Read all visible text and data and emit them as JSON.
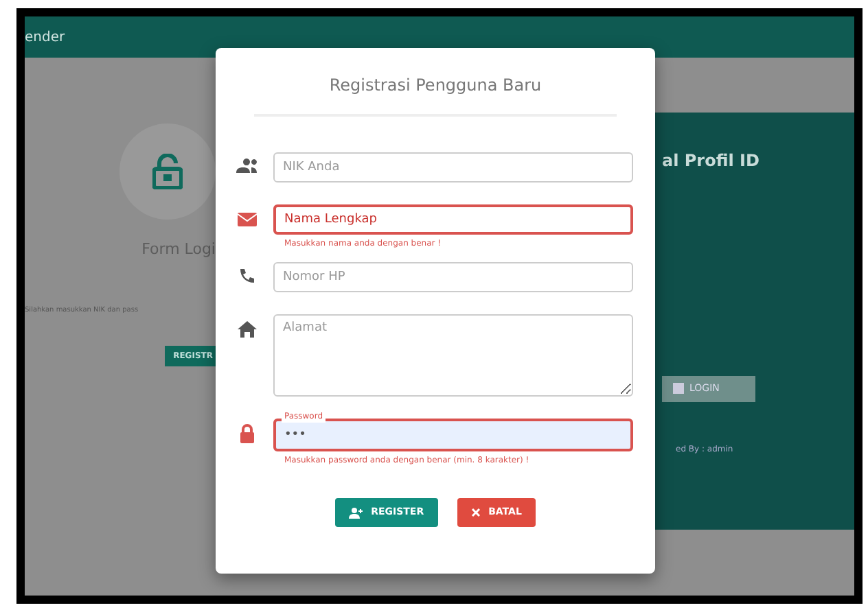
{
  "header": {
    "title": "ender"
  },
  "login_card": {
    "title": "Form Logi",
    "text": "Silahkan masukkan NIK dan pass",
    "register_button": "REGISTR"
  },
  "profile_panel": {
    "title": "al Profil ID",
    "login_button": "LOGIN",
    "footer": "ed By : admin"
  },
  "modal": {
    "title": "Registrasi Pengguna Baru",
    "fields": [
      {
        "kind": "input",
        "placeholder": "NIK Anda",
        "invalid": false
      },
      {
        "kind": "input",
        "placeholder": "Nama Lengkap",
        "invalid": true,
        "error": "Masukkan nama anda dengan benar !"
      },
      {
        "kind": "input",
        "placeholder": "Nomor HP",
        "invalid": false
      },
      {
        "kind": "textarea",
        "placeholder": "Alamat",
        "invalid": false
      },
      {
        "kind": "floating",
        "label": "Password",
        "value": "•••",
        "invalid": true,
        "error": "Masukkan password anda dengan benar (min. 8 karakter) !"
      }
    ],
    "buttons": [
      {
        "kind": "primary",
        "label": "REGISTER"
      },
      {
        "kind": "danger",
        "label": "BATAL"
      }
    ]
  }
}
